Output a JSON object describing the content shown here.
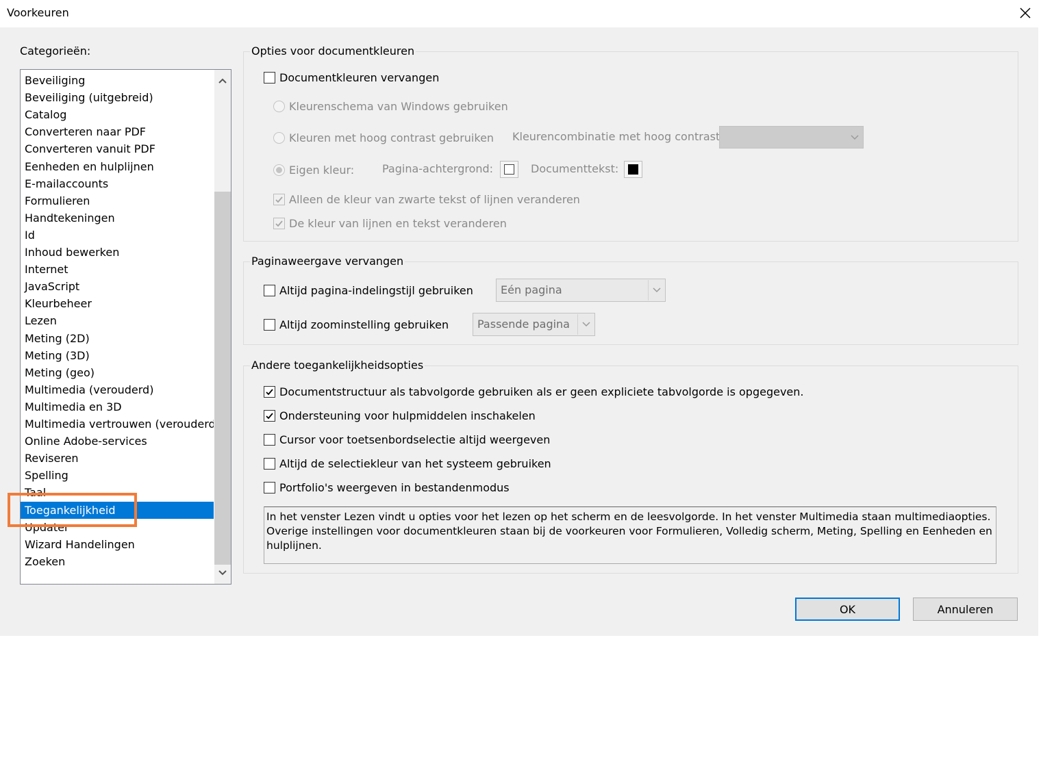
{
  "window": {
    "title": "Voorkeuren"
  },
  "categories": {
    "label": "Categorieën:",
    "items": [
      "Beveiliging",
      "Beveiliging (uitgebreid)",
      "Catalog",
      "Converteren naar PDF",
      "Converteren vanuit PDF",
      "Eenheden en hulplijnen",
      "E-mailaccounts",
      "Formulieren",
      "Handtekeningen",
      "Id",
      "Inhoud bewerken",
      "Internet",
      "JavaScript",
      "Kleurbeheer",
      "Lezen",
      "Meting (2D)",
      "Meting (3D)",
      "Meting (geo)",
      "Multimedia (verouderd)",
      "Multimedia en 3D",
      "Multimedia vertrouwen (verouderd)",
      "Online Adobe-services",
      "Reviseren",
      "Spelling",
      "Taal",
      "Toegankelijkheid",
      "Updater",
      "Wizard Handelingen",
      "Zoeken"
    ],
    "selected": "Toegankelijkheid"
  },
  "doc_colors": {
    "title": "Opties voor documentkleuren",
    "replace": {
      "label": "Documentkleuren vervangen",
      "checked": false
    },
    "windows_scheme": {
      "label": "Kleurenschema van Windows gebruiken"
    },
    "high_contrast": {
      "label": "Kleuren met hoog contrast gebruiken",
      "combo_label": "Kleurencombinatie met hoog contrast:",
      "combo_value": ""
    },
    "custom": {
      "label": "Eigen kleur:",
      "bg_label": "Pagina-achtergrond:",
      "bg_color": "#ffffff",
      "text_label": "Documenttekst:",
      "text_color": "#000000"
    },
    "only_black": {
      "label": "Alleen de kleur van zwarte tekst of lijnen veranderen",
      "checked": true
    },
    "lines_text": {
      "label": "De kleur van lijnen en tekst veranderen",
      "checked": true
    }
  },
  "page_display": {
    "title": "Paginaweergave vervangen",
    "layout": {
      "label": "Altijd pagina-indelingstijl gebruiken",
      "checked": false,
      "value": "Eén pagina"
    },
    "zoom": {
      "label": "Altijd zoominstelling gebruiken",
      "checked": false,
      "value": "Passende pagina"
    }
  },
  "other": {
    "title": "Andere toegankelijkheidsopties",
    "items": [
      {
        "label": "Documentstructuur als tabvolgorde gebruiken als er geen expliciete tabvolgorde is opgegeven.",
        "checked": true
      },
      {
        "label": "Ondersteuning voor hulpmiddelen inschakelen",
        "checked": true
      },
      {
        "label": "Cursor voor toetsenbordselectie altijd weergeven",
        "checked": false
      },
      {
        "label": "Altijd de selectiekleur van het systeem gebruiken",
        "checked": false
      },
      {
        "label": "Portfolio's weergeven in bestandenmodus",
        "checked": false
      }
    ],
    "info": "In het venster Lezen vindt u opties voor het lezen op het scherm en de leesvolgorde. In het venster Multimedia staan multimediaopties. Overige instellingen voor documentkleuren staan bij de voorkeuren voor Formulieren, Volledig scherm, Meting, Spelling en Eenheden en hulplijnen."
  },
  "buttons": {
    "ok": "OK",
    "cancel": "Annuleren"
  },
  "colors": {
    "accent": "#0078d7",
    "highlight": "#f07c3a"
  }
}
